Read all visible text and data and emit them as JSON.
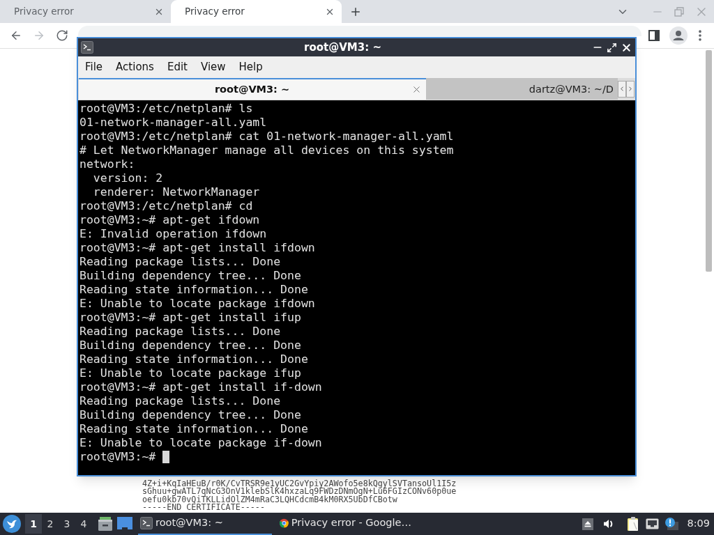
{
  "browser": {
    "tabs": [
      {
        "title": "Privacy error",
        "selected": false
      },
      {
        "title": "Privacy error",
        "selected": true
      }
    ],
    "nav_buttons": [
      {
        "kind": "back",
        "disabled": false
      },
      {
        "kind": "forward",
        "disabled": true
      },
      {
        "kind": "reload",
        "disabled": false
      }
    ],
    "page_lines": [
      "4Z+i+KqIaHEuB/r0K/CvTRSR9e1yUC2GvYpiy2AWofo5e8kQgylSVTansoUl1I5z",
      "sGhuu+gwATL7qNcG3OnV1klebSlK4hxzaLq9FWDzDNmOgN+Lu6FGIzCONv60p0ue",
      "oefu0kb70vQiTKLLidOlZM4mRaC3LQHCdcmB4kM0RX5UbDfCBotw",
      "-----END CERTIFICATE-----"
    ]
  },
  "terminal": {
    "title": "root@VM3: ~",
    "menu": [
      "File",
      "Actions",
      "Edit",
      "View",
      "Help"
    ],
    "tabs": [
      {
        "title": "root@VM3: ~",
        "selected": true
      },
      {
        "title": "dartz@VM3: ~/D",
        "selected": false
      }
    ],
    "lines": [
      "root@VM3:/etc/netplan# ls",
      "01-network-manager-all.yaml",
      "root@VM3:/etc/netplan# cat 01-network-manager-all.yaml",
      "# Let NetworkManager manage all devices on this system",
      "network:",
      "  version: 2",
      "  renderer: NetworkManager",
      "root@VM3:/etc/netplan# cd",
      "root@VM3:~# apt-get ifdown",
      "E: Invalid operation ifdown",
      "root@VM3:~# apt-get install ifdown",
      "Reading package lists... Done",
      "Building dependency tree... Done",
      "Reading state information... Done",
      "E: Unable to locate package ifdown",
      "root@VM3:~# apt-get install ifup",
      "Reading package lists... Done",
      "Building dependency tree... Done",
      "Reading state information... Done",
      "E: Unable to locate package ifup",
      "root@VM3:~# apt-get install if-down",
      "Reading package lists... Done",
      "Building dependency tree... Done",
      "Reading state information... Done",
      "E: Unable to locate package if-down",
      "root@VM3:~#"
    ]
  },
  "taskbar": {
    "workspaces": [
      {
        "label": "1",
        "selected": true
      },
      {
        "label": "2",
        "selected": false
      },
      {
        "label": "3",
        "selected": false
      },
      {
        "label": "4",
        "selected": false
      }
    ],
    "tasks": [
      {
        "kind": "terminal",
        "title": "root@VM3: ~",
        "selected": true
      },
      {
        "kind": "browser",
        "title": "Privacy error - Google…",
        "selected": false
      }
    ],
    "clock": "8:09"
  }
}
